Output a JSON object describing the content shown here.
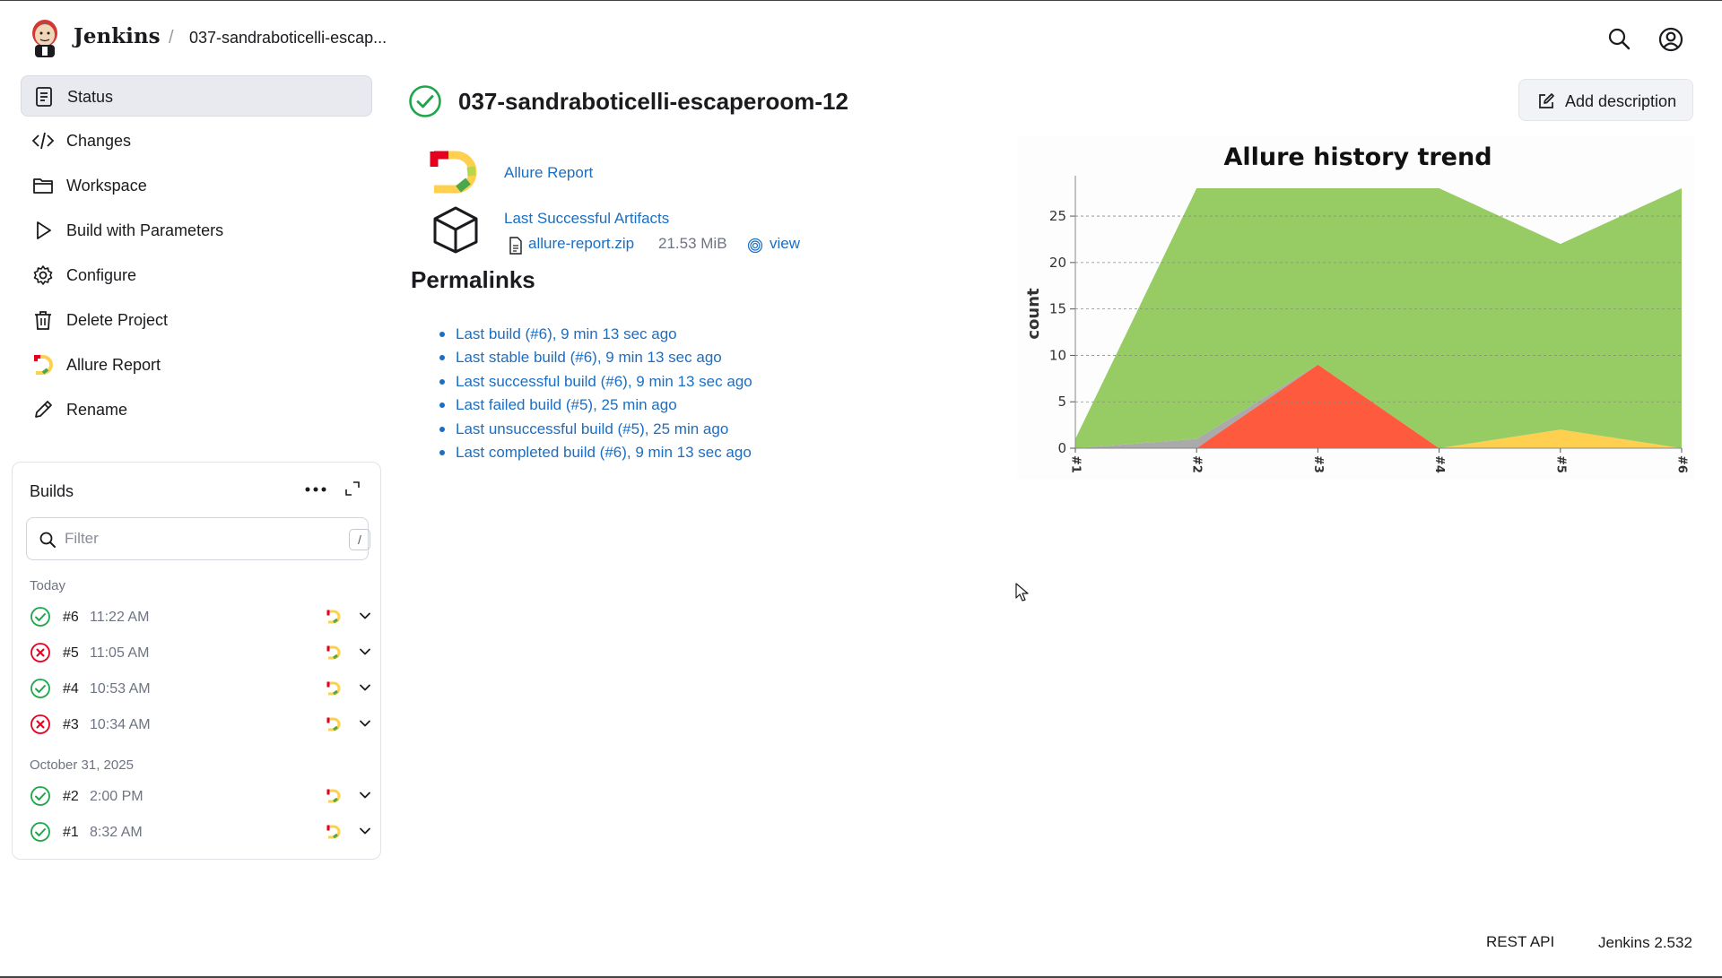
{
  "header": {
    "brand": "Jenkins",
    "breadcrumb_separator": "/",
    "breadcrumb_job": "037-sandraboticelli-escap...",
    "icons": [
      "jenkins-logo-icon",
      "search-icon",
      "user-icon"
    ]
  },
  "sidebar": {
    "items": [
      {
        "label": "Status",
        "icon": "document-icon",
        "active": true
      },
      {
        "label": "Changes",
        "icon": "code-icon",
        "active": false
      },
      {
        "label": "Workspace",
        "icon": "folder-icon",
        "active": false
      },
      {
        "label": "Build with Parameters",
        "icon": "play-icon",
        "active": false
      },
      {
        "label": "Configure",
        "icon": "gear-icon",
        "active": false
      },
      {
        "label": "Delete Project",
        "icon": "trash-icon",
        "active": false
      },
      {
        "label": "Allure Report",
        "icon": "allure-icon",
        "active": false
      },
      {
        "label": "Rename",
        "icon": "pencil-icon",
        "active": false
      }
    ]
  },
  "builds": {
    "title": "Builds",
    "filter_placeholder": "Filter",
    "filter_shortcut": "/",
    "groups": [
      {
        "label": "Today",
        "rows": [
          {
            "number": "#6",
            "time": "11:22 AM",
            "status": "success"
          },
          {
            "number": "#5",
            "time": "11:05 AM",
            "status": "failed"
          },
          {
            "number": "#4",
            "time": "10:53 AM",
            "status": "success"
          },
          {
            "number": "#3",
            "time": "10:34 AM",
            "status": "failed"
          }
        ]
      },
      {
        "label": "October 31, 2025",
        "rows": [
          {
            "number": "#2",
            "time": "2:00 PM",
            "status": "success"
          },
          {
            "number": "#1",
            "time": "8:32 AM",
            "status": "success"
          }
        ]
      }
    ]
  },
  "main": {
    "title": "037-sandraboticelli-escaperoom-12",
    "status": "success",
    "add_description": "Add description",
    "allure_report": "Allure Report",
    "last_successful_artifacts": "Last Successful Artifacts",
    "artifact_file": "allure-report.zip",
    "artifact_size": "21.53 MiB",
    "artifact_view": "view",
    "permalinks_title": "Permalinks",
    "permalinks": [
      "Last build (#6), 9 min 13 sec ago",
      "Last stable build (#6), 9 min 13 sec ago",
      "Last successful build (#6), 9 min 13 sec ago",
      "Last failed build (#5), 25 min ago",
      "Last unsuccessful build (#5), 25 min ago",
      "Last completed build (#6), 9 min 13 sec ago"
    ]
  },
  "colors": {
    "link": "#1b6ec2",
    "passed": "#97cc64",
    "failed": "#fd5a3e",
    "broken": "#ffd050",
    "skipped": "#aaaaaa",
    "success_icon": "#1ea64b",
    "failed_icon": "#e6001f"
  },
  "chart_data": {
    "type": "area",
    "stacked": true,
    "title": "Allure history trend",
    "xlabel": "",
    "ylabel": "count",
    "categories": [
      "#1",
      "#2",
      "#3",
      "#4",
      "#5",
      "#6"
    ],
    "ylim": [
      0,
      28
    ],
    "yticks": [
      0,
      5,
      10,
      15,
      20,
      25
    ],
    "grid": true,
    "series": [
      {
        "key": "failed",
        "values": [
          0,
          0,
          9,
          0,
          0,
          0
        ],
        "color": "#fd5a3e"
      },
      {
        "key": "broken",
        "values": [
          0,
          0,
          0,
          0,
          2,
          0
        ],
        "color": "#ffd050"
      },
      {
        "key": "skipped",
        "values": [
          0,
          1,
          0,
          0,
          0,
          0
        ],
        "color": "#aaaaaa"
      },
      {
        "key": "passed",
        "values": [
          1,
          27,
          19,
          28,
          20,
          28
        ],
        "color": "#97cc64"
      }
    ]
  },
  "footer": {
    "rest_api": "REST API",
    "version": "Jenkins 2.532"
  }
}
